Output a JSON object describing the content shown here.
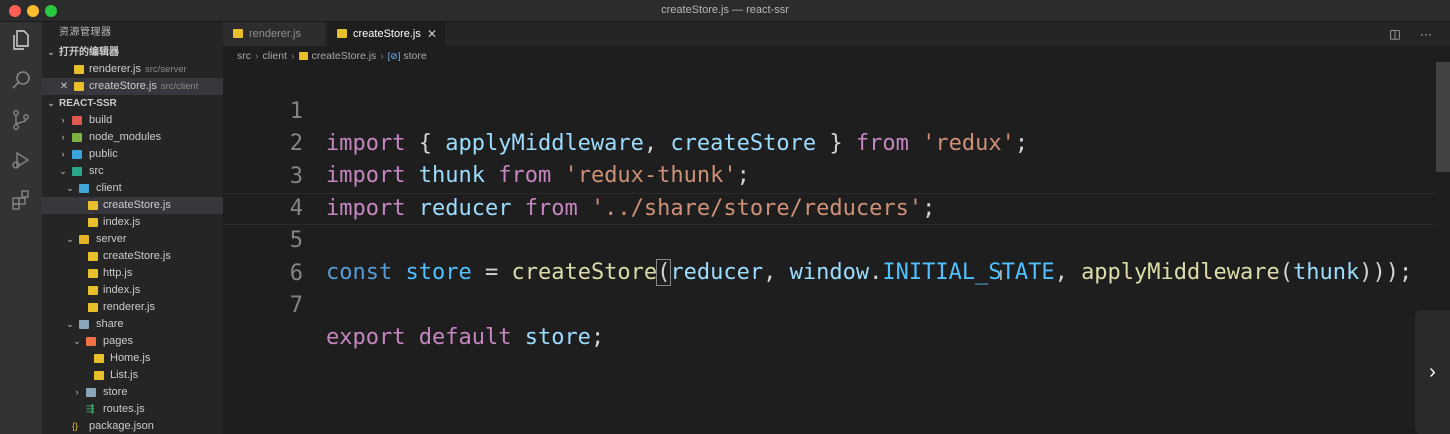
{
  "window": {
    "title": "createStore.js — react-ssr"
  },
  "activity_icons": [
    "files-icon",
    "search-icon",
    "source-control-icon",
    "run-debug-icon",
    "extensions-icon"
  ],
  "sidebar": {
    "header": "资源管理器",
    "open_editors_label": "打开的编辑器",
    "open_editors": [
      {
        "name": "renderer.js",
        "hint": "src/server"
      },
      {
        "name": "createStore.js",
        "hint": "src/client",
        "close": "✕"
      }
    ],
    "project_label": "REACT-SSR",
    "tree": [
      {
        "name": "build",
        "chev": "›"
      },
      {
        "name": "node_modules",
        "chev": "›"
      },
      {
        "name": "public",
        "chev": "›"
      },
      {
        "name": "src",
        "chev": "⌄"
      },
      {
        "name": "client",
        "chev": "⌄"
      },
      {
        "name": "createStore.js"
      },
      {
        "name": "index.js"
      },
      {
        "name": "server",
        "chev": "⌄"
      },
      {
        "name": "createStore.js"
      },
      {
        "name": "http.js"
      },
      {
        "name": "index.js"
      },
      {
        "name": "renderer.js"
      },
      {
        "name": "share",
        "chev": "⌄"
      },
      {
        "name": "pages",
        "chev": "⌄"
      },
      {
        "name": "Home.js"
      },
      {
        "name": "List.js"
      },
      {
        "name": "store",
        "chev": "›"
      },
      {
        "name": "routes.js"
      },
      {
        "name": "package.json"
      }
    ]
  },
  "tabs": [
    {
      "label": "renderer.js"
    },
    {
      "label": "createStore.js",
      "close": "✕"
    }
  ],
  "tab_actions": {
    "split": "◫",
    "more": "···"
  },
  "breadcrumb": {
    "p1": "src",
    "p2": "client",
    "p3": "createStore.js",
    "p4": "store",
    "sep": "›",
    "var_icon": "[⊘]"
  },
  "editor": {
    "line_numbers": [
      "1",
      "2",
      "3",
      "4",
      "5",
      "6",
      "7"
    ],
    "line1": {
      "k1": "import",
      "t1": " { ",
      "v1": "applyMiddleware",
      "t2": ", ",
      "v2": "createStore",
      "t3": " } ",
      "k2": "from",
      "t4": " ",
      "s1": "'redux'",
      "t5": ";"
    },
    "line2": {
      "k1": "import",
      "t1": " ",
      "v1": "thunk",
      "t2": " ",
      "k2": "from",
      "t3": " ",
      "s1": "'redux-thunk'",
      "t4": ";"
    },
    "line3": {
      "k1": "import",
      "t1": " ",
      "v1": "reducer",
      "t2": " ",
      "k2": "from",
      "t3": " ",
      "s1": "'../share/store/reducers'",
      "t4": ";"
    },
    "line5": {
      "k1": "const",
      "t1": " ",
      "c1": "store",
      "t2": " = ",
      "f1": "createStore",
      "b1": "(",
      "v1": "reducer",
      "t3": ", ",
      "v2": "window",
      "t4": ".",
      "c2": "INITIAL_STATE",
      "t5": ", ",
      "f2": "applyMiddleware",
      "t6": "(",
      "v3": "thunk",
      "t7": ")));"
    },
    "line7": {
      "k1": "export",
      "t1": " ",
      "k2": "default",
      "t2": " ",
      "v1": "store",
      "t3": ";"
    },
    "cursor": "I"
  },
  "side_button": "›",
  "colors": {
    "keyword": "#c586c0",
    "string": "#ce9178",
    "variable": "#9cdcfe",
    "function": "#dcdcaa",
    "constant": "#4fc1ff",
    "js_icon": "#e8c02c"
  }
}
